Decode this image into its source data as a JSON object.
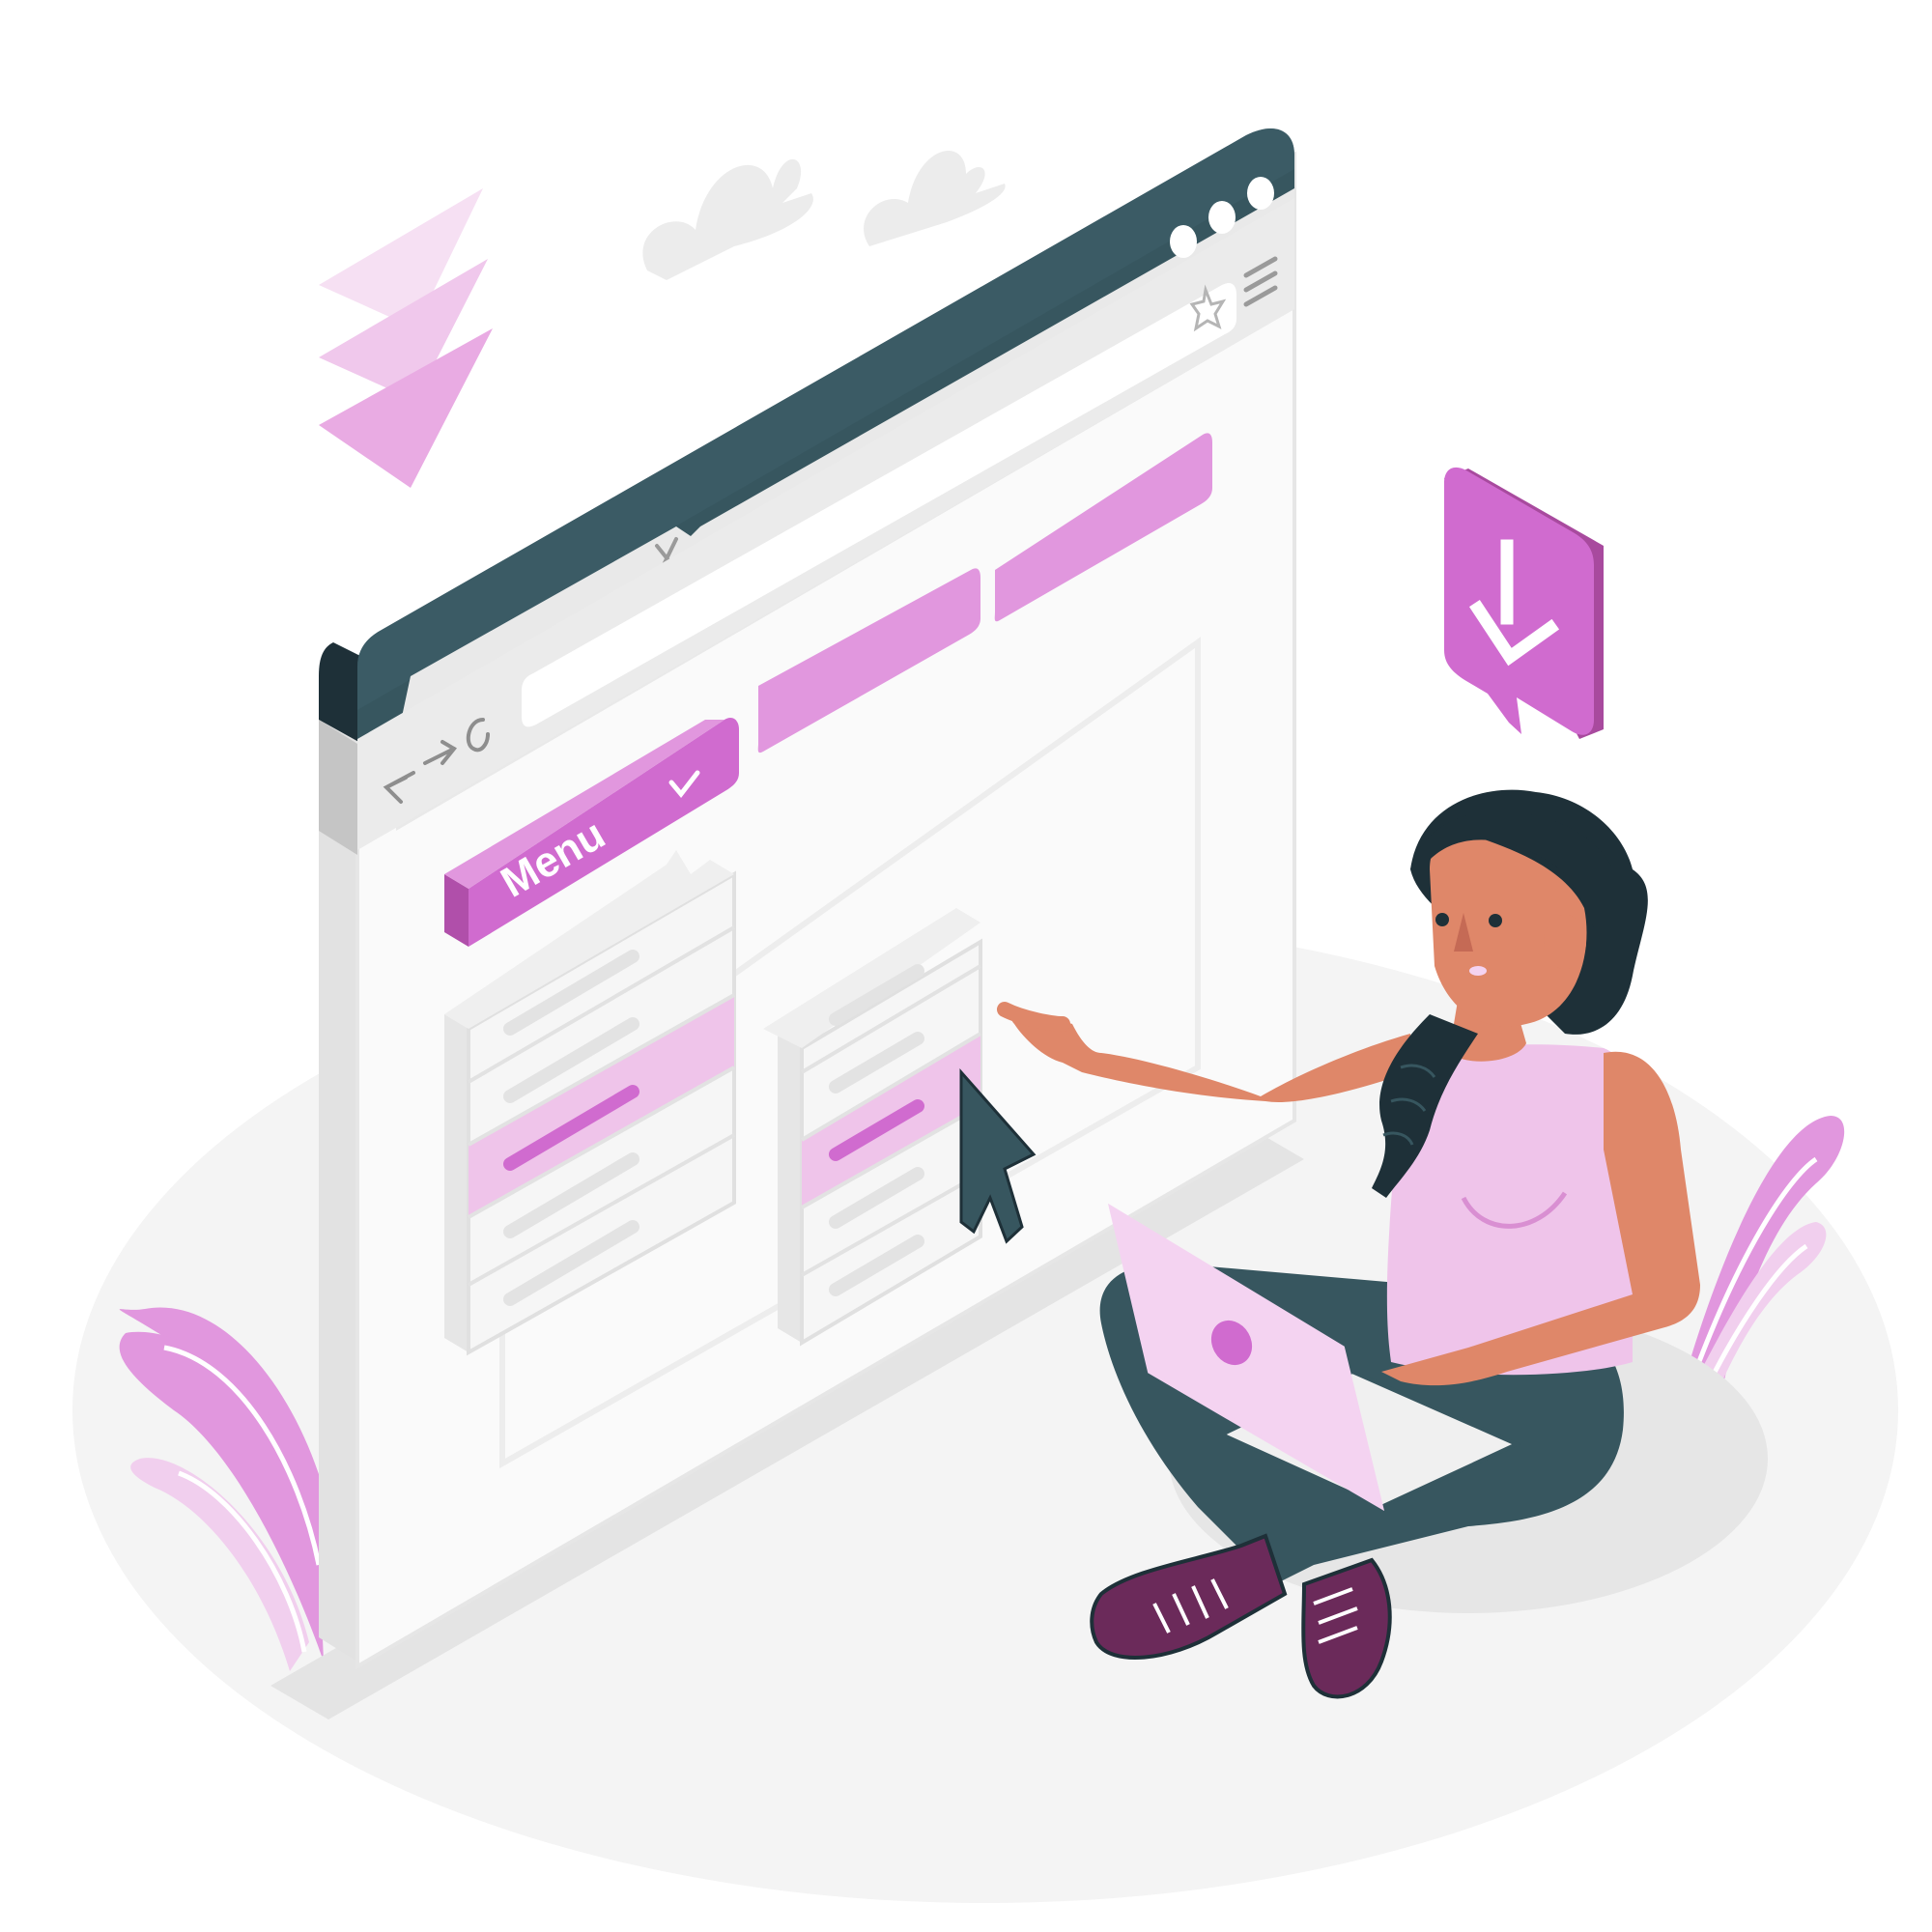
{
  "colors": {
    "accent": "#D06BCF",
    "accent_light": "#E197DE",
    "accent_pale": "#EFC4EA",
    "dark": "#37565F",
    "dark_deep": "#1E3038",
    "skin": "#DF8769",
    "shoe": "#6B2A5A",
    "ground": "#F3F3F3"
  },
  "browser": {
    "window_dots_icon": "more-dots-icon",
    "close_tab_icon": "close-icon",
    "back_icon": "arrow-left-icon",
    "forward_icon": "arrow-right-icon",
    "reload_icon": "reload-icon",
    "bookmark_icon": "star-icon",
    "menu_icon": "hamburger-icon"
  },
  "menu_button": {
    "label": "Menu",
    "check_icon": "check-icon"
  },
  "download_badge": {
    "icon": "download-arrow-icon"
  },
  "cursor": {
    "icon": "mouse-pointer-icon"
  }
}
